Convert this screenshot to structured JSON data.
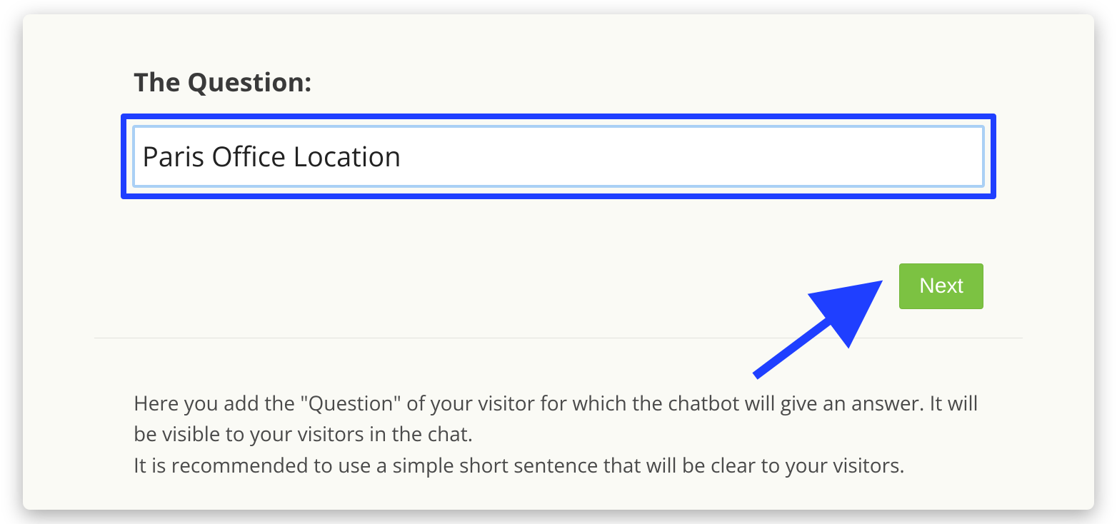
{
  "form": {
    "label": "The Question:",
    "input_value": "Paris Office Location",
    "next_button_label": "Next"
  },
  "help": {
    "line1": "Here you add the \"Question\" of your visitor for which the chatbot will give an answer. It will be visible to your visitors in the chat.",
    "line2": "It is recommended to use a simple short sentence that will be clear to your visitors."
  },
  "colors": {
    "highlight": "#1f3fff",
    "button_bg": "#7cc242"
  }
}
